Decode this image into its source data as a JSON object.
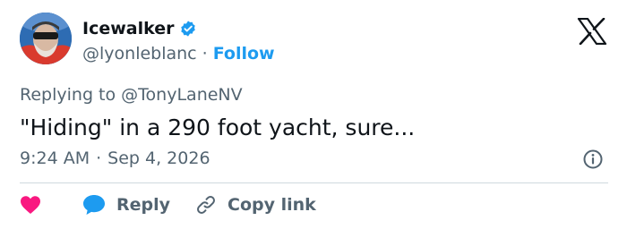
{
  "author": {
    "display_name": "Icewalker",
    "handle": "@lyonleblanc",
    "separator": "·",
    "follow_label": "Follow"
  },
  "tweet": {
    "reply_prefix": "Replying to",
    "reply_to": "@TonyLaneNV",
    "text": "\"Hiding\" in a 290 foot yacht, sure...",
    "time": "9:24 AM",
    "date_separator": "·",
    "date": "Sep 4, 2026"
  },
  "actions": {
    "reply_label": "Reply",
    "copy_label": "Copy link"
  },
  "icons": {
    "verified": "verified-badge-icon",
    "logo": "x-logo-icon",
    "info": "info-icon",
    "like": "heart-icon",
    "reply": "speech-bubble-icon",
    "copy": "link-icon"
  },
  "colors": {
    "accent": "#1d9bf0",
    "like": "#f91880",
    "text": "#0f1419",
    "secondary": "#536471",
    "divider": "#cfd9de"
  }
}
